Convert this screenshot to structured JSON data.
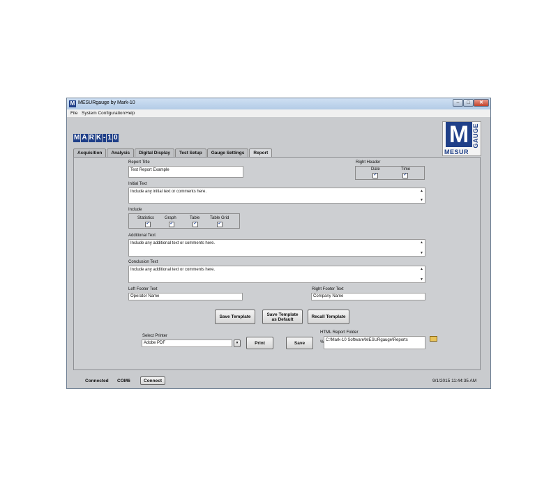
{
  "window": {
    "title": "MESURgauge by Mark-10",
    "controls": {
      "minimize": "–",
      "maximize": "□",
      "close": "✕"
    }
  },
  "menu": [
    "File",
    "System Configuration",
    "Help"
  ],
  "logo": {
    "brand_letters": [
      "M",
      "A",
      "R",
      "K",
      "-",
      "1",
      "0"
    ],
    "mesur": "MESUR",
    "gauge": "GAUGE",
    "m": "M"
  },
  "tabs": [
    "Acquisition",
    "Analysis",
    "Digital Display",
    "Test Setup",
    "Gauge Settings",
    "Report"
  ],
  "active_tab": "Report",
  "report": {
    "report_title_label": "Report Title",
    "report_title_value": "Test Report Example",
    "right_header_label": "Right Header",
    "right_header_options": [
      {
        "label": "Date",
        "checked": true
      },
      {
        "label": "Time",
        "checked": true
      }
    ],
    "initial_text_label": "Initial Text",
    "initial_text_value": "Include any initial text or comments here.",
    "include_label": "Include",
    "include_options": [
      {
        "label": "Statistics",
        "checked": true
      },
      {
        "label": "Graph",
        "checked": true
      },
      {
        "label": "Table",
        "checked": true
      },
      {
        "label": "Table Grid",
        "checked": true
      }
    ],
    "additional_text_label": "Additional Text",
    "additional_text_value": "Include any additional text or comments here.",
    "conclusion_text_label": "Conclusion Text",
    "conclusion_text_value": "Include any additional text or comments here.",
    "left_footer_label": "Left Footer Text",
    "left_footer_value": "Operator Name",
    "right_footer_label": "Right Footer Text",
    "right_footer_value": "Company Name",
    "buttons": {
      "save_template": "Save Template",
      "save_template_default_line1": "Save Template",
      "save_template_default_line2": "as Default",
      "recall_template": "Recall Template",
      "print": "Print",
      "save": "Save"
    },
    "select_printer_label": "Select Printer",
    "select_printer_value": "Adobe PDF",
    "html_folder_label": "HTML Report Folder",
    "html_folder_value": "C:\\Mark-10 Software\\MESURgauge\\Reports",
    "path_prefix": "%"
  },
  "status": {
    "connected": "Connected",
    "port": "COM6",
    "connect_button": "Connect",
    "timestamp": "9/1/2015 11:44:35 AM"
  },
  "icons": {
    "checkbox": "✓",
    "scroll_up": "▲",
    "scroll_down": "▼",
    "dropdown": "▼"
  }
}
